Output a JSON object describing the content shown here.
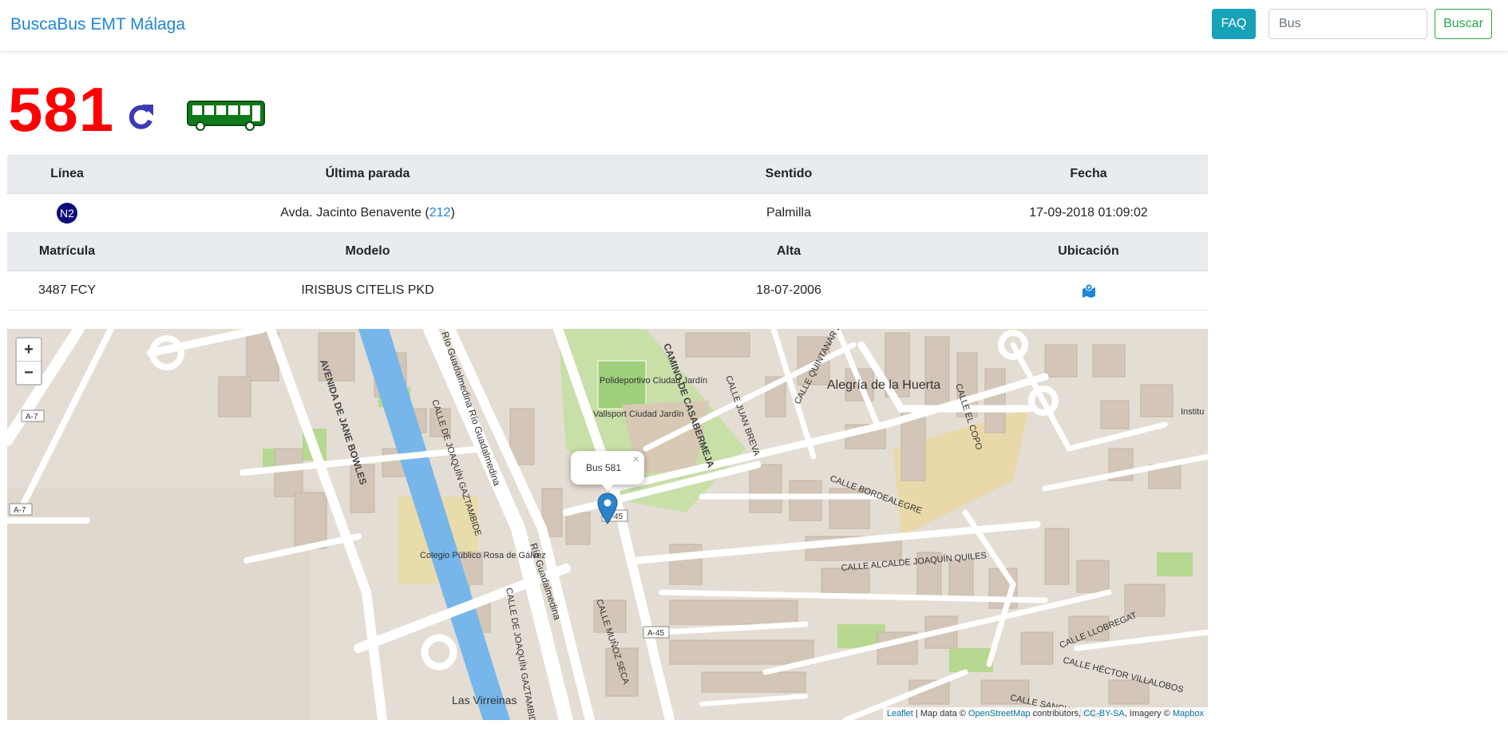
{
  "navbar": {
    "brand": "BuscaBus EMT Málaga",
    "faq_label": "FAQ",
    "search_placeholder": "Bus",
    "search_value": "",
    "search_button": "Buscar"
  },
  "bus": {
    "number": "581",
    "icons": [
      "refresh-icon",
      "bus-icon"
    ]
  },
  "info_table": {
    "headers": [
      "Línea",
      "Última parada",
      "Sentido",
      "Fecha"
    ],
    "line_badge": "N2",
    "stop_name": "Avda. Jacinto Benavente (",
    "stop_code": "212",
    "stop_suffix": ")",
    "direction": "Palmilla",
    "date": "17-09-2018 01:09:02"
  },
  "vehicle_table": {
    "headers": [
      "Matrícula",
      "Modelo",
      "Alta",
      "Ubicación"
    ],
    "plate": "3487 FCY",
    "model": "IRISBUS CITELIS PKD",
    "registered": "18-07-2006",
    "location_icon": "map-marked-icon"
  },
  "map": {
    "zoom_in": "+",
    "zoom_out": "−",
    "popup_text": "Bus 581",
    "popup_close": "×",
    "labels": {
      "avenida": "AVENIDA DE JANE BOWLES",
      "rio1": "Río Guadalmedina Río Guadalmedina",
      "rio2": "Río Guadalmedina",
      "calle_joaquin1": "CALLE DE JOAQUÍN GAZTAMBIDE",
      "calle_joaquin2": "CALLE DE JOAQUÍN GAZTAMBIDE",
      "camino": "CAMINO DE CASABERMEJA",
      "juan_breva": "CALLE JUAN BREVA",
      "quintanar": "CALLE QUINTANAR DE LA ORDEN",
      "el_copo": "CALLE EL COPO",
      "bordealegre": "CALLE BORDEALEGRE",
      "alcalde": "CALLE ALCALDE JOAQUÍN QUILES",
      "llobregat": "CALLE LLOBREGAT",
      "villalobos": "CALLE HÉCTOR VILLALOBOS",
      "sancho": "CALLE SANCHO MIRA",
      "munoz": "CALLE MUÑOZ SECA",
      "polideportivo": "Polideportivo Ciudad Jardín",
      "vallsport": "Vallsport Ciudad Jardín",
      "colegio": "Colegio Público Rosa de Gálvez",
      "alegria": "Alegría de la Huerta",
      "virreinas": "Las Virreinas",
      "instituto": "Institu",
      "a7_1": "A-7",
      "a7_2": "A-7",
      "a45_1": "A-45",
      "a45_2": "A-45"
    },
    "attribution": {
      "leaflet": "Leaflet",
      "mapdata": " | Map data © ",
      "osm": "OpenStreetMap",
      "contrib": " contributors, ",
      "ccbysa": "CC-BY-SA",
      "imagery": ", Imagery © ",
      "mapbox": "Mapbox"
    }
  },
  "colors": {
    "brand": "#1e86d8",
    "bus_number": "#ff0000",
    "faq": "#17a2b8",
    "buscar": "#28a745",
    "river": "#76b6ea",
    "park": "#c8dfa8",
    "building": "#d6cbbf",
    "road": "#ffffff"
  }
}
